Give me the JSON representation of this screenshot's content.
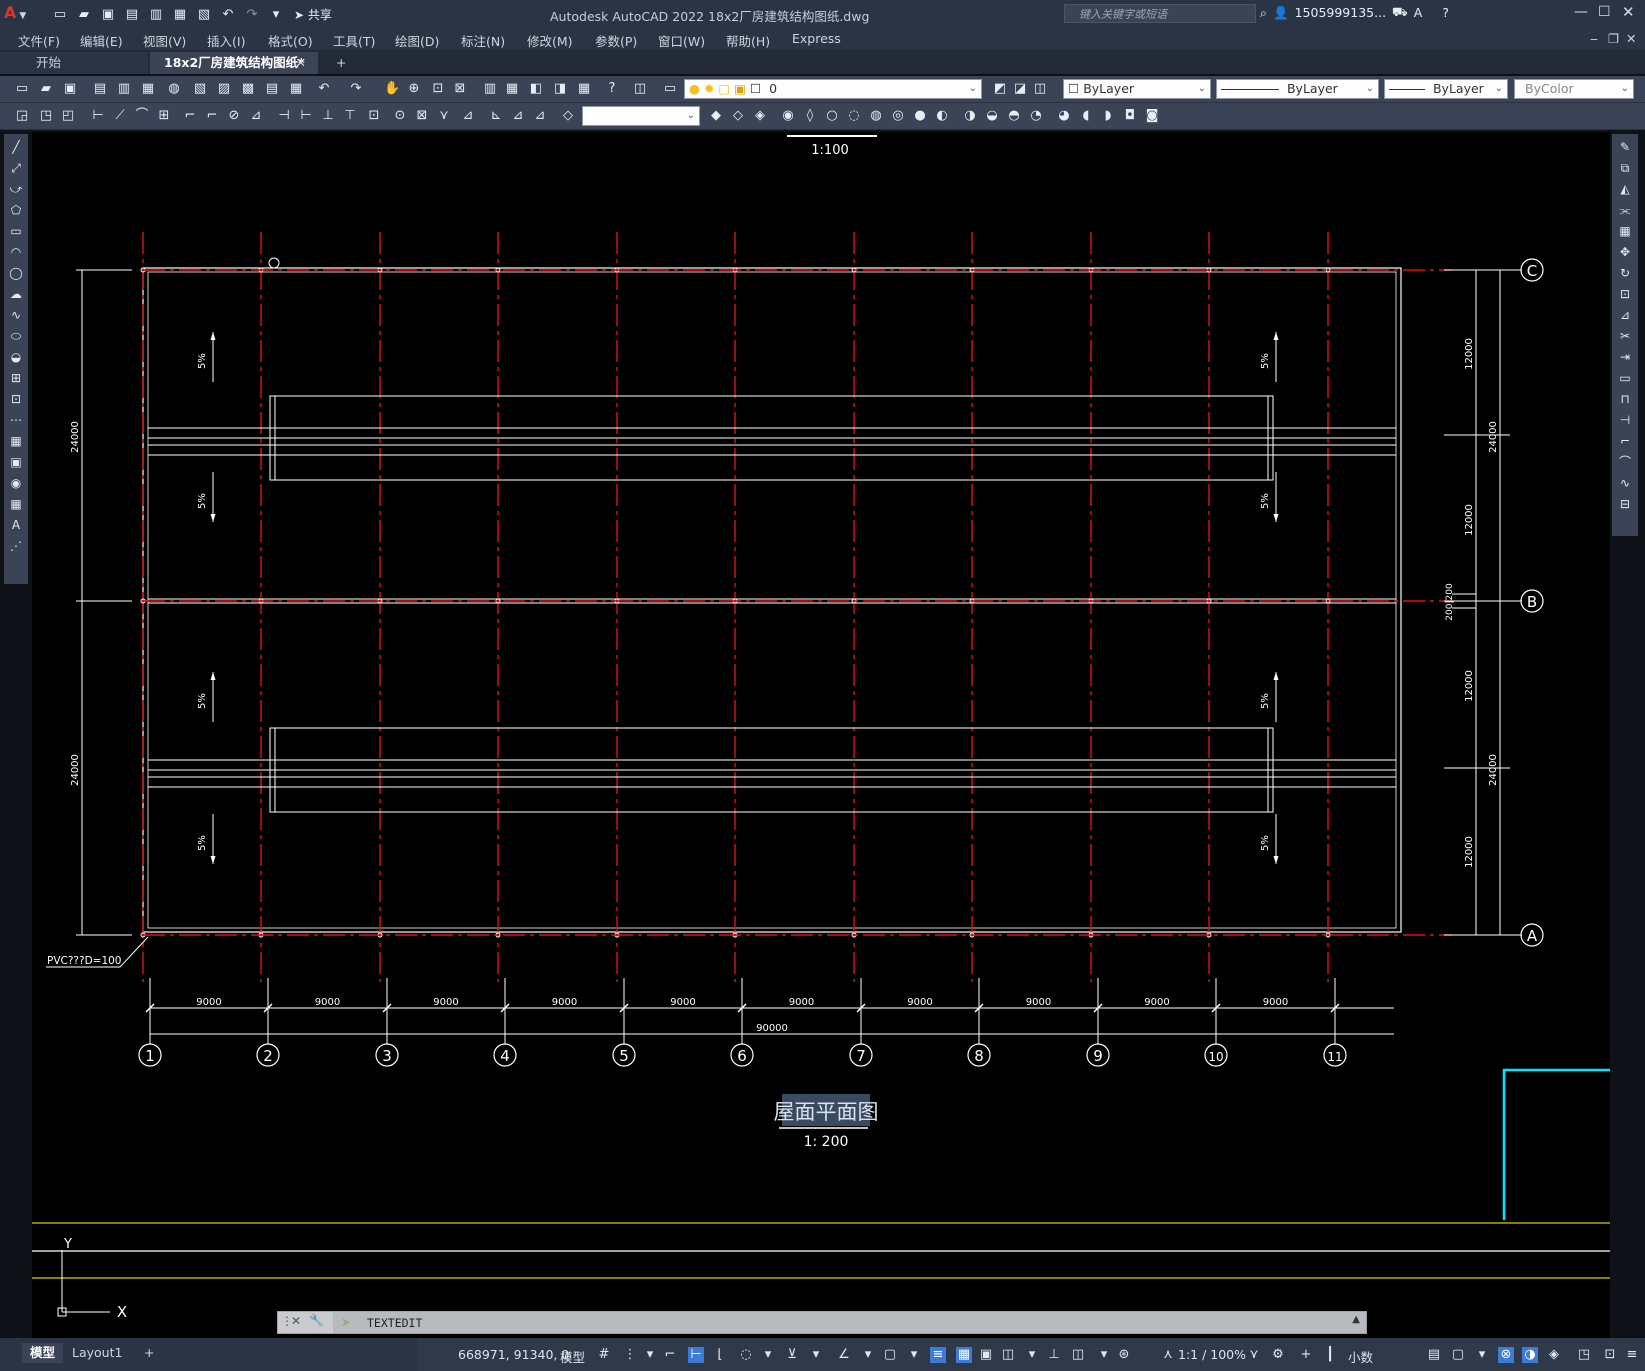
{
  "titlebar": {
    "app_logo": "A",
    "title": "Autodesk AutoCAD 2022    18x2厂房建筑结构图纸.dwg",
    "share_label": "共享",
    "search_placeholder": "键入关键字或短语",
    "user": "1505999135...",
    "qat_icons": [
      "new-icon",
      "open-icon",
      "save-icon",
      "saveas-icon",
      "publish-icon",
      "export-icon",
      "print-icon",
      "undo-icon",
      "redo-icon",
      "workspace-icon"
    ]
  },
  "menubar": {
    "items": [
      "文件(F)",
      "编辑(E)",
      "视图(V)",
      "插入(I)",
      "格式(O)",
      "工具(T)",
      "绘图(D)",
      "标注(N)",
      "修改(M)",
      "参数(P)",
      "窗口(W)",
      "帮助(H)",
      "Express"
    ]
  },
  "tabs": {
    "items": [
      {
        "label": "开始",
        "active": false
      },
      {
        "label": "18x2厂房建筑结构图纸*",
        "active": true
      }
    ],
    "add": "+"
  },
  "layers": {
    "current_layer": "0",
    "color": "ByLayer",
    "linetype": "ByLayer",
    "lineweight": "ByLayer",
    "plotstyle": "ByColor"
  },
  "drawing": {
    "top_scale": "1:100",
    "title": "屋面平面图",
    "scale": "1: 200",
    "grid_columns": [
      "1",
      "2",
      "3",
      "4",
      "5",
      "6",
      "7",
      "8",
      "9",
      "10",
      "11"
    ],
    "grid_rows": [
      "C",
      "B",
      "A"
    ],
    "bay_dims": [
      "9000",
      "9000",
      "9000",
      "9000",
      "9000",
      "9000",
      "9000",
      "9000",
      "9000",
      "9000"
    ],
    "total_dim": "90000",
    "left_dims": [
      "24000",
      "24000"
    ],
    "right_outer_dims": [
      "24000",
      "24000"
    ],
    "right_inner_dims": [
      "12000",
      "12000",
      "12000",
      "12000"
    ],
    "right_mid_dim": "200|200",
    "slope": "5%",
    "pvc_note": "PVC???D=100",
    "ucs_x": "X",
    "ucs_y": "Y"
  },
  "cmdline": {
    "command": "TEXTEDIT"
  },
  "statusbar": {
    "layout_tabs": [
      "模型",
      "Layout1"
    ],
    "coords": "668971, 91340, 0",
    "space": "模型",
    "annoscale": "1:1 / 100%",
    "units": "小数"
  },
  "colors": {
    "grid_red": "#e01010",
    "cyan": "#00e5ff",
    "yellow_line": "#d4d000",
    "ui_dark": "#2b3444",
    "ui_mid": "#3b4456"
  }
}
